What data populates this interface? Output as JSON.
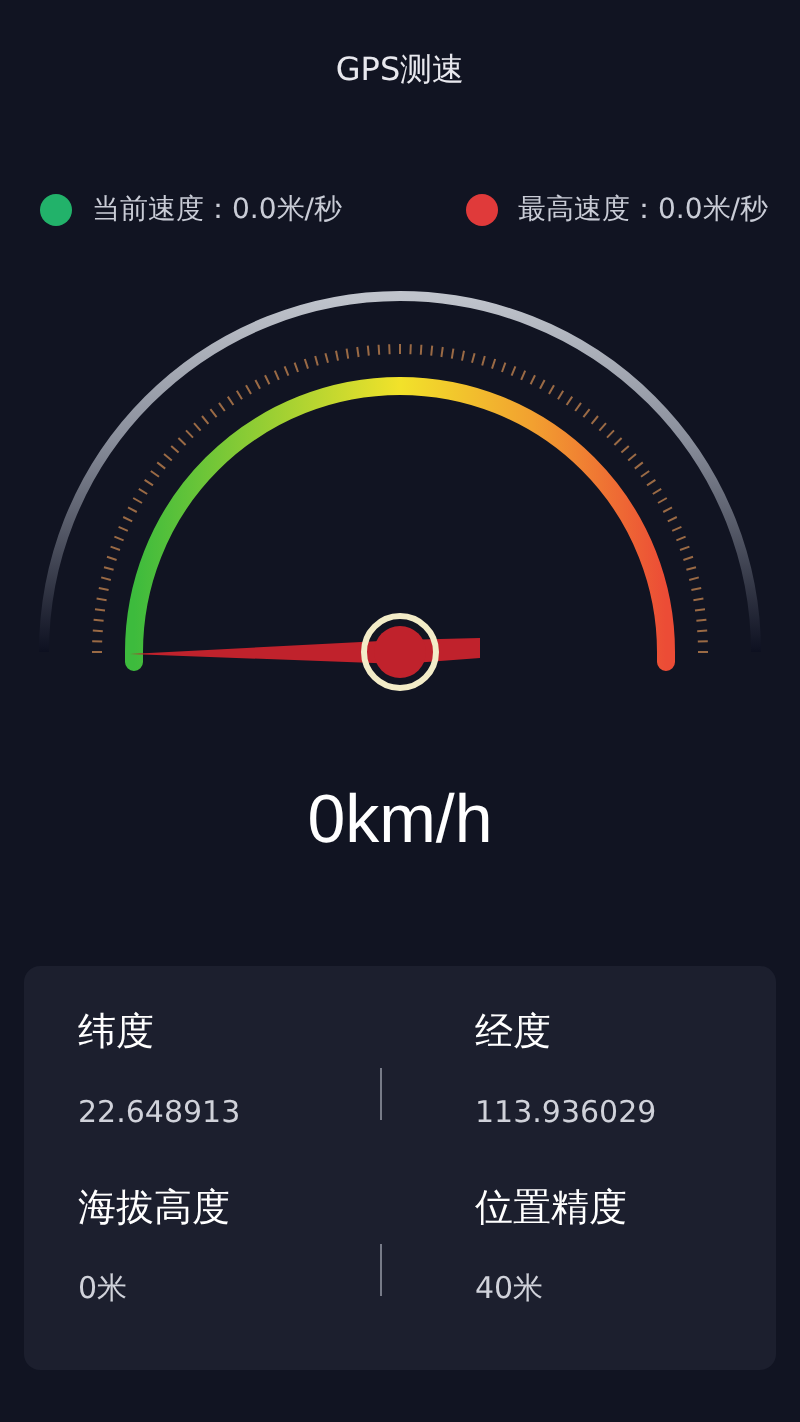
{
  "title": "GPS测速",
  "legend": [
    {
      "label": "当前速度：0.0米/秒",
      "color": "#22b26a"
    },
    {
      "label": "最高速度：0.0米/秒",
      "color": "#e03a3a"
    }
  ],
  "speed": "0km/h",
  "stats": [
    [
      {
        "label": "纬度",
        "value": "22.648913"
      },
      {
        "label": "经度",
        "value": "113.936029"
      }
    ],
    [
      {
        "label": "海拔高度",
        "value": "0米"
      },
      {
        "label": "位置精度",
        "value": "40米"
      }
    ]
  ]
}
